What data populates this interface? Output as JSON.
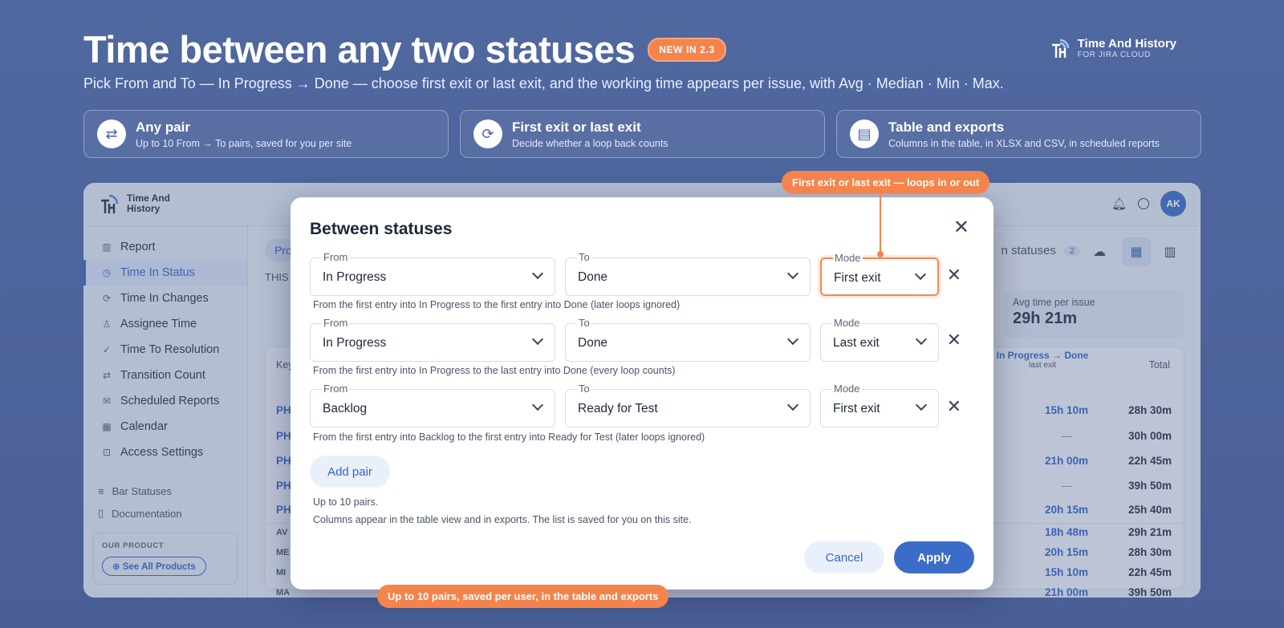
{
  "hero": {
    "title": "Time between any two statuses",
    "badge": "NEW IN 2.3",
    "subtitle": "Pick From and To — In Progress → Done — choose first exit or last exit, and the working time appears per issue, with Avg · Median · Min · Max."
  },
  "brand": {
    "name": "Time And History",
    "tagline": "FOR JIRA CLOUD"
  },
  "features": [
    {
      "title": "Any pair",
      "desc": "Up to 10 From → To pairs, saved for you per site",
      "icon": "swap-icon"
    },
    {
      "title": "First exit or last exit",
      "desc": "Decide whether a loop back counts",
      "icon": "refresh-icon"
    },
    {
      "title": "Table and exports",
      "desc": "Columns in the table, in XLSX and CSV, in scheduled reports",
      "icon": "document-icon"
    }
  ],
  "app": {
    "logo_line1": "Time And",
    "logo_line2": "History",
    "avatar": "AK",
    "sidebar": [
      {
        "label": "Report",
        "icon": "chart-icon",
        "active": false
      },
      {
        "label": "Time In Status",
        "icon": "clock-icon",
        "active": true
      },
      {
        "label": "Time In Changes",
        "icon": "refresh-icon",
        "active": false
      },
      {
        "label": "Assignee Time",
        "icon": "user-icon",
        "active": false
      },
      {
        "label": "Time To Resolution",
        "icon": "check-circle-icon",
        "active": false
      },
      {
        "label": "Transition Count",
        "icon": "transition-icon",
        "active": false
      },
      {
        "label": "Scheduled Reports",
        "icon": "mail-icon",
        "active": false
      },
      {
        "label": "Calendar",
        "icon": "calendar-icon",
        "active": false
      },
      {
        "label": "Access Settings",
        "icon": "lock-icon",
        "active": false
      }
    ],
    "sidebar_secondary": [
      {
        "label": "Bar Statuses",
        "icon": "list-icon"
      },
      {
        "label": "Documentation",
        "icon": "doc-icon"
      }
    ],
    "our_product_label": "OUR PRODUCT",
    "see_all_label": "See All Products",
    "pill_partial": "Pro",
    "this_partial": "THIS",
    "statuses_label": "n statuses",
    "statuses_count": "2",
    "avg_card": {
      "label": "Avg time per issue",
      "value": "29h 21m"
    },
    "table": {
      "key_header": "Key",
      "pair_header": "In Progress → Done",
      "pair_subheader": "last exit",
      "total_header": "Total",
      "rows": [
        {
          "key": "PH",
          "pair": "15h 10m",
          "total": "28h 30m"
        },
        {
          "key": "PH",
          "pair": "—",
          "total": "30h 00m"
        },
        {
          "key": "PH",
          "pair": "21h 00m",
          "total": "22h 45m"
        },
        {
          "key": "PH",
          "pair": "—",
          "total": "39h 50m"
        },
        {
          "key": "PH",
          "pair": "20h 15m",
          "total": "25h 40m"
        }
      ],
      "aggregates": [
        {
          "key": "AV",
          "pair": "18h 48m",
          "total": "29h 21m"
        },
        {
          "key": "ME",
          "pair": "20h 15m",
          "total": "28h 30m"
        },
        {
          "key": "MI",
          "pair": "15h 10m",
          "total": "22h 45m"
        },
        {
          "key": "MA",
          "pair": "21h 00m",
          "total": "39h 50m"
        }
      ]
    }
  },
  "modal": {
    "title": "Between statuses",
    "from_label": "From",
    "to_label": "To",
    "mode_label": "Mode",
    "pairs": [
      {
        "from": "In Progress",
        "to": "Done",
        "mode": "First exit",
        "hint": "From the first entry into In Progress to the first entry into Done (later loops ignored)"
      },
      {
        "from": "In Progress",
        "to": "Done",
        "mode": "Last exit",
        "hint": "From the first entry into In Progress to the last entry into Done (every loop counts)"
      },
      {
        "from": "Backlog",
        "to": "Ready for Test",
        "mode": "First exit",
        "hint": "From the first entry into Backlog to the first entry into Ready for Test (later loops ignored)"
      }
    ],
    "add_pair": "Add pair",
    "note1": "Up to 10 pairs.",
    "note2": "Columns appear in the table view and in exports. The list is saved for you on this site.",
    "cancel": "Cancel",
    "apply": "Apply"
  },
  "callouts": {
    "top": "First exit or last exit — loops in or out",
    "bottom": "Up to 10 pairs, saved per user, in the table and exports"
  },
  "colors": {
    "accent": "#f4844c",
    "primary": "#3a6cc8",
    "background": "#4e65a0"
  }
}
